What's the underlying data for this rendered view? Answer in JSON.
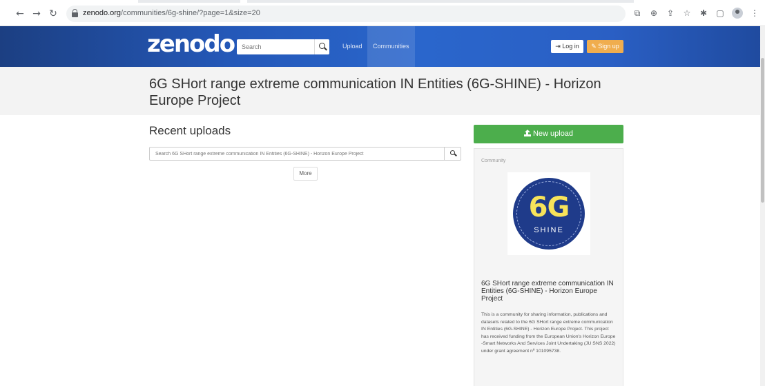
{
  "browser": {
    "url_host": "zenodo.org",
    "url_path": "/communities/6g-shine/?page=1&size=20"
  },
  "navbar": {
    "logo": "zenodo",
    "search_placeholder": "Search",
    "links": {
      "upload": "Upload",
      "communities": "Communities"
    },
    "login_label": "Log in",
    "signup_label": "Sign up"
  },
  "page": {
    "title": "6G SHort range extreme communication IN Entities (6G-SHINE) - Horizon Europe Project"
  },
  "main": {
    "section_title": "Recent uploads",
    "search_placeholder": "Search 6G SHort range extreme communication IN Entities (6G-SHINE) - Horizon Europe Project",
    "more_label": "More"
  },
  "sidebar": {
    "new_upload_label": "New upload",
    "community_label": "Community",
    "logo_text_top": "6G",
    "logo_text_bottom": "SHINE",
    "community_title": "6G SHort range extreme communication IN Entities (6G-SHINE) - Horizon Europe Project",
    "community_description": "This is a community for sharing information, publications and datasets related to the 6G SHort range extreme communication IN Entities (6G-SHINE) - Horizon Europe Project. This project has received funding from the European Union's Horizon Europe -Smart Networks And Services Joint Undertaking (JU SNS 2022) under grant agreement nº 101095738."
  },
  "colors": {
    "navbar_blue": "#2a66cc",
    "new_upload_green": "#4cae4c",
    "signup_orange": "#f0ad4e",
    "logo_badge_blue": "#1f3b8a",
    "logo_badge_yellow": "#f7e35a"
  }
}
